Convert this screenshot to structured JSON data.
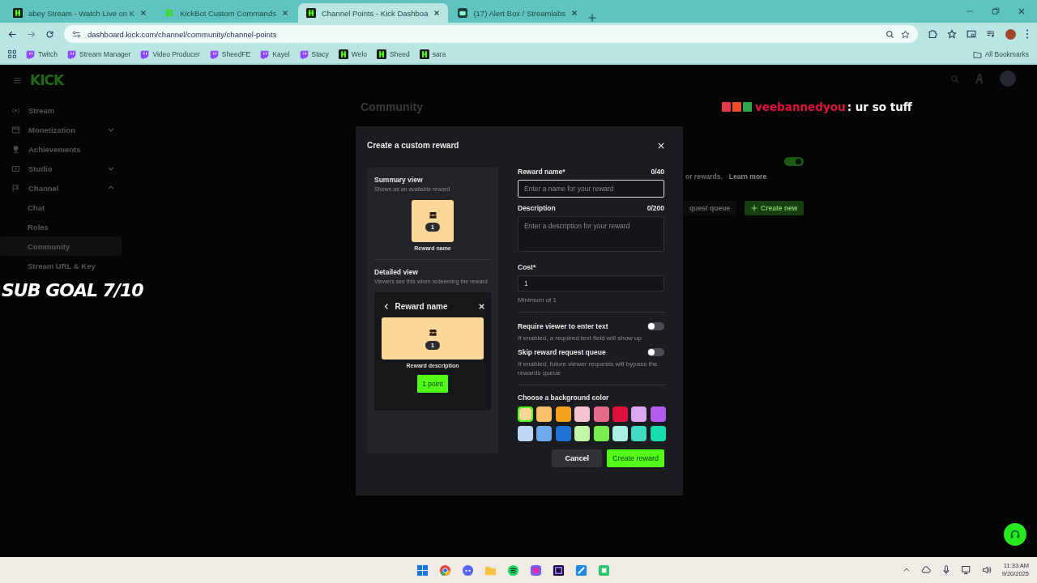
{
  "browser": {
    "tabs": [
      {
        "title": "abey Stream - Watch Live on K",
        "kind": "kick",
        "selected": false
      },
      {
        "title": "KickBot Custom Commands",
        "kind": "kickbot",
        "selected": false
      },
      {
        "title": "Channel Points - Kick Dashboa",
        "kind": "kick",
        "selected": true
      },
      {
        "title": "(17) Alert Box / Streamlabs",
        "kind": "streamlabs",
        "selected": false
      }
    ],
    "url": "dashboard.kick.com/channel/community/channel-points",
    "bookmarks": [
      {
        "label": "Twitch",
        "kind": "twitch"
      },
      {
        "label": "Stream Manager",
        "kind": "twitch"
      },
      {
        "label": "Video Producer",
        "kind": "twitch"
      },
      {
        "label": "SheedFE",
        "kind": "twitch"
      },
      {
        "label": "Kayel",
        "kind": "twitch"
      },
      {
        "label": "Stacy",
        "kind": "twitch"
      },
      {
        "label": "Welo",
        "kind": "kick"
      },
      {
        "label": "Sheed",
        "kind": "kick"
      },
      {
        "label": "sara",
        "kind": "kick"
      }
    ],
    "all_bookmarks": "All Bookmarks"
  },
  "header": {
    "logo": "KICK"
  },
  "sidebar": {
    "items": [
      {
        "label": "Stream",
        "selected": false
      },
      {
        "label": "Monetization",
        "expanded": false,
        "selected": false
      },
      {
        "label": "Achievements",
        "selected": false
      },
      {
        "label": "Studio",
        "expanded": false,
        "selected": false
      },
      {
        "label": "Channel",
        "expanded": true,
        "selected": false,
        "children": [
          {
            "label": "Chat",
            "selected": false
          },
          {
            "label": "Roles",
            "selected": false
          },
          {
            "label": "Community",
            "selected": true
          },
          {
            "label": "Stream URL & Key",
            "selected": false
          }
        ]
      }
    ]
  },
  "page": {
    "title": "Community",
    "enabled": true,
    "hint_fragment": "or rewards.",
    "learn_more": "Learn more",
    "queue_button": "quest queue",
    "create_button": "Create new"
  },
  "overlay": {
    "sub_goal": "SUB GOAL 7/10",
    "chat": {
      "username": "veebannedyou",
      "message": ": ur so tuff"
    }
  },
  "modal": {
    "title": "Create a custom reward",
    "summary": {
      "title": "Summary view",
      "subtitle": "Shown as an available reward",
      "cost": "1",
      "name": "Reward name"
    },
    "detailed": {
      "title": "Detailed view",
      "subtitle": "Viewers see this when redeeming the reward",
      "name": "Reward name",
      "cost": "1",
      "description": "Reward description",
      "points_button": "1 point"
    },
    "name_field": {
      "label": "Reward name*",
      "counter": "0/40",
      "placeholder": "Enter a name for your reward"
    },
    "description_field": {
      "label": "Description",
      "counter": "0/200",
      "placeholder": "Enter a description for your reward"
    },
    "cost_field": {
      "label": "Cost*",
      "value": "1",
      "hint": "Minimum of 1"
    },
    "toggles": [
      {
        "label": "Require viewer to enter text",
        "help": "If enabled, a required text field will show up",
        "on": false
      },
      {
        "label": "Skip reward request queue",
        "help": "If enabled, future viewer requests will bypass the rewards queue",
        "on": false
      }
    ],
    "color_label": "Choose a background color",
    "colors": [
      {
        "color": "#fcd79a",
        "selected": true
      },
      {
        "color": "#f6c06a",
        "selected": false
      },
      {
        "color": "#f4a01c",
        "selected": false
      },
      {
        "color": "#f6c2d0",
        "selected": false
      },
      {
        "color": "#e86a8a",
        "selected": false
      },
      {
        "color": "#e0103c",
        "selected": false
      },
      {
        "color": "#dca6f0",
        "selected": false
      },
      {
        "color": "#b45cf0",
        "selected": false
      },
      {
        "color": "#bcd8f6",
        "selected": false
      },
      {
        "color": "#6ea8e8",
        "selected": false
      },
      {
        "color": "#1e70d8",
        "selected": false
      },
      {
        "color": "#c0f8a8",
        "selected": false
      },
      {
        "color": "#78ee50",
        "selected": false
      },
      {
        "color": "#a8f0e4",
        "selected": false
      },
      {
        "color": "#40dcc0",
        "selected": false
      },
      {
        "color": "#18dcb0",
        "selected": false
      }
    ],
    "cancel": "Cancel",
    "create": "Create reward"
  },
  "taskbar": {
    "time": "11:33 AM",
    "date": "9/20/2025"
  }
}
